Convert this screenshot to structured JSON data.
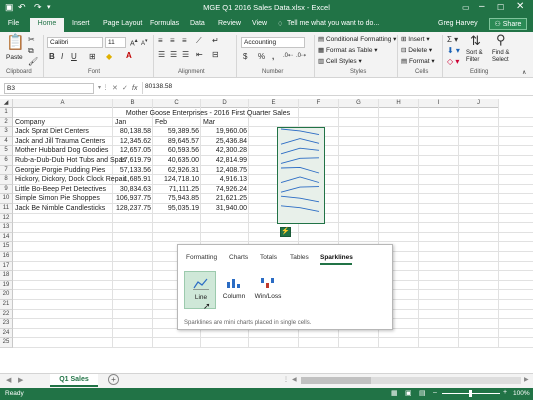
{
  "window": {
    "title": "MGE Q1 2016 Sales Data.xlsx - Excel"
  },
  "tabs": {
    "items": [
      "File",
      "Home",
      "Insert",
      "Page Layout",
      "Formulas",
      "Data",
      "Review",
      "View"
    ],
    "tell_me": "Tell me what you want to do...",
    "user": "Greg Harvey",
    "share": "Share"
  },
  "ribbon": {
    "clipboard": {
      "paste": "Paste",
      "label": "Clipboard"
    },
    "font": {
      "name": "Calibri",
      "size": "11",
      "label": "Font"
    },
    "alignment": {
      "label": "Alignment"
    },
    "number": {
      "format": "Accounting",
      "dollar": "$",
      "percent": "%",
      "comma": ",",
      "label": "Number"
    },
    "styles": {
      "conditional": "Conditional Formatting",
      "format_table": "Format as Table",
      "cell_styles": "Cell Styles",
      "label": "Styles"
    },
    "cells": {
      "insert": "Insert",
      "delete": "Delete",
      "format": "Format",
      "label": "Cells"
    },
    "editing": {
      "sort": "Sort &",
      "filter": "Filter",
      "find": "Find &",
      "select": "Select",
      "label": "Editing"
    }
  },
  "formula_bar": {
    "name_box": "B3",
    "fx": "fx",
    "value": "80138.58"
  },
  "columns": [
    "A",
    "B",
    "C",
    "D",
    "E",
    "F",
    "G",
    "H",
    "I",
    "J"
  ],
  "rows": [
    "1",
    "2",
    "3",
    "4",
    "5",
    "6",
    "7",
    "8",
    "9",
    "10",
    "11",
    "12",
    "13",
    "14",
    "15",
    "16",
    "17",
    "18",
    "19",
    "20",
    "21",
    "22",
    "23",
    "24",
    "25"
  ],
  "sheet": {
    "title": "Mother Goose Enterprises - 2016 First Quarter Sales",
    "headers": [
      "Company",
      "Jan",
      "Feb",
      "Mar"
    ],
    "data": [
      [
        "Jack Sprat Diet Centers",
        "80,138.58",
        "59,389.56",
        "19,960.06"
      ],
      [
        "Jack and Jill Trauma Centers",
        "12,345.62",
        "89,645.57",
        "25,436.84"
      ],
      [
        "Mother Hubbard Dog Goodies",
        "12,657.05",
        "60,593.56",
        "42,300.28"
      ],
      [
        "Rub-a-Dub-Dub Hot Tubs and Spas",
        "17,619.79",
        "40,635.00",
        "42,814.99"
      ],
      [
        "Georgie Porgie Pudding Pies",
        "57,133.56",
        "62,926.31",
        "12,408.75"
      ],
      [
        "Hickory, Dickory, Dock Clock Repair",
        "1,685.91",
        "124,718.10",
        "4,916.13"
      ],
      [
        "Little Bo-Beep Pet Detectives",
        "30,834.63",
        "71,111.25",
        "74,926.24"
      ],
      [
        "Simple Simon Pie Shoppes",
        "106,937.75",
        "75,943.85",
        "21,621.25"
      ],
      [
        "Jack Be Nimble Candlesticks",
        "128,237.75",
        "95,035.19",
        "31,940.00"
      ]
    ]
  },
  "quick_analysis": {
    "tabs": [
      "Formatting",
      "Charts",
      "Totals",
      "Tables",
      "Sparklines"
    ],
    "options": [
      "Line",
      "Column",
      "Win/Loss"
    ],
    "description": "Sparklines are mini charts placed in single cells."
  },
  "sheet_tabs": {
    "active": "Q1 Sales",
    "add": "+"
  },
  "status": {
    "ready": "Ready",
    "zoom": "100%"
  }
}
